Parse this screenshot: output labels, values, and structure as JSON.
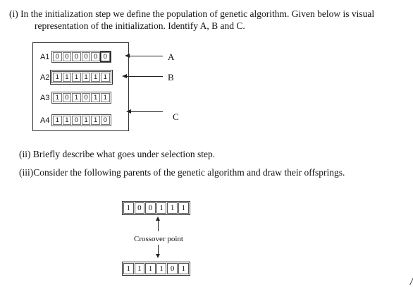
{
  "q1": {
    "line1": "(i) In the initialization step we define the population of genetic algorithm. Given below is visual",
    "line2": "representation of the initialization. Identify A, B and C."
  },
  "population": [
    {
      "label": "A1",
      "genes": [
        "0",
        "0",
        "0",
        "0",
        "0",
        "0"
      ]
    },
    {
      "label": "A2",
      "genes": [
        "1",
        "1",
        "1",
        "1",
        "1",
        "1"
      ]
    },
    {
      "label": "A3",
      "genes": [
        "1",
        "0",
        "1",
        "0",
        "1",
        "1"
      ]
    },
    {
      "label": "A4",
      "genes": [
        "1",
        "1",
        "0",
        "1",
        "1",
        "0"
      ]
    }
  ],
  "tags": {
    "a": "A",
    "b": "B",
    "c": "C"
  },
  "q2": "(ii) Briefly describe what goes under selection step.",
  "q3": "(iii)Consider the following parents of the genetic algorithm and draw their offsprings.",
  "crossover": {
    "parent1": [
      "1",
      "0",
      "0",
      "1",
      "1",
      "1"
    ],
    "parent2": [
      "1",
      "1",
      "1",
      "1",
      "0",
      "1"
    ],
    "label": "Crossover point"
  }
}
